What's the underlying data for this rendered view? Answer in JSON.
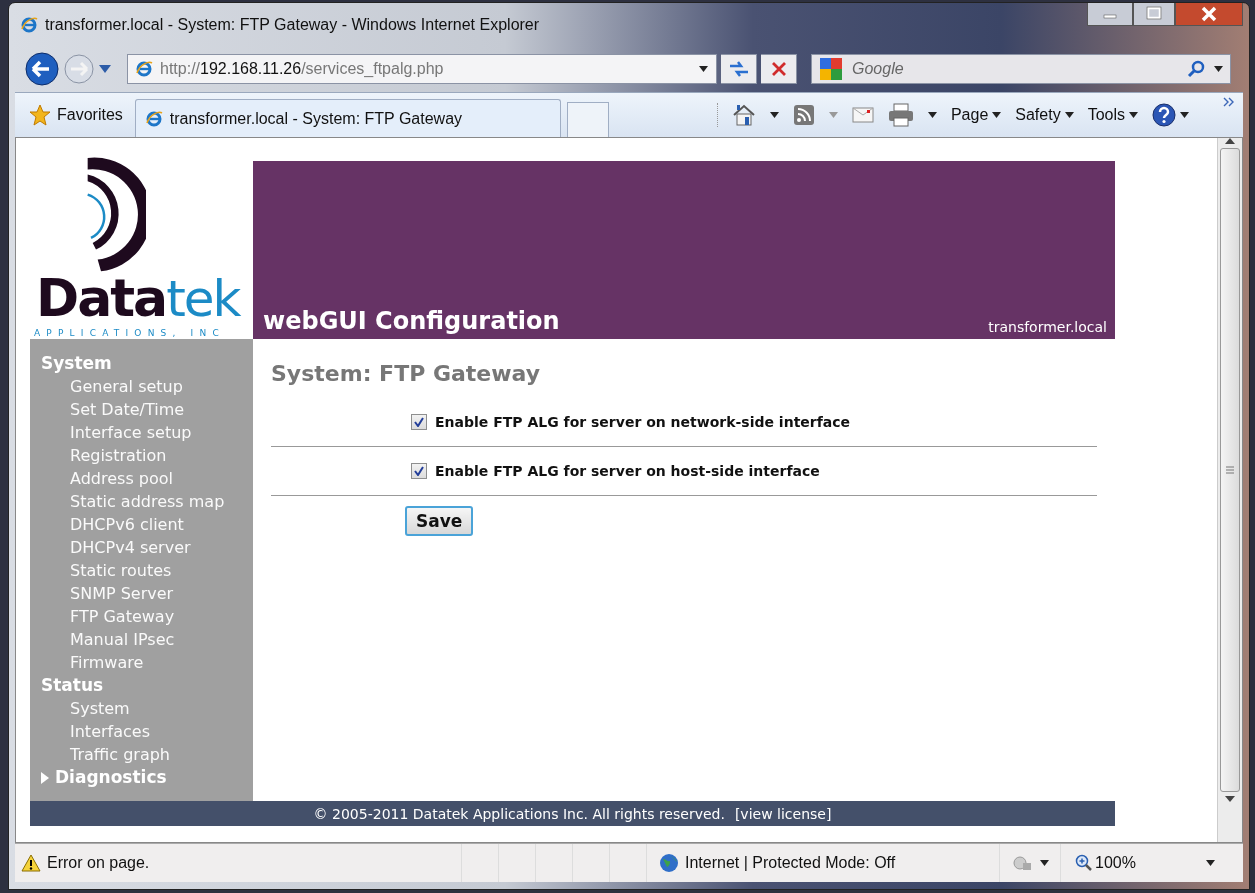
{
  "window": {
    "title": "transformer.local - System: FTP Gateway - Windows Internet Explorer"
  },
  "address_bar": {
    "scheme": "http://",
    "host": "192.168.11.26",
    "path": "/services_ftpalg.php"
  },
  "search": {
    "placeholder": "Google"
  },
  "favorites_label": "Favorites",
  "tabs": [
    {
      "label": "transformer.local - System: FTP Gateway",
      "selected": true
    }
  ],
  "commands": [
    {
      "label": "Page"
    },
    {
      "label": "Safety"
    },
    {
      "label": "Tools"
    }
  ],
  "page": {
    "logo": {
      "word_bold": "Data",
      "word_light": "tek",
      "tagline": "APPLICATIONS, INC"
    },
    "banner": {
      "title": "webGUI Configuration",
      "hostname": "transformer.local"
    },
    "sidebar": [
      {
        "label": "System",
        "expanded": true,
        "children": [
          {
            "label": "General setup"
          },
          {
            "label": "Set Date/Time"
          },
          {
            "label": "Interface setup"
          },
          {
            "label": "Registration"
          },
          {
            "label": "Address pool"
          },
          {
            "label": "Static address map"
          },
          {
            "label": "DHCPv6 client"
          },
          {
            "label": "DHCPv4 server"
          },
          {
            "label": "Static routes"
          },
          {
            "label": "SNMP Server"
          },
          {
            "label": "FTP Gateway"
          },
          {
            "label": "Manual IPsec"
          },
          {
            "label": "Firmware"
          }
        ]
      },
      {
        "label": "Status",
        "expanded": true,
        "children": [
          {
            "label": "System"
          },
          {
            "label": "Interfaces"
          },
          {
            "label": "Traffic graph"
          }
        ]
      },
      {
        "label": "Diagnostics",
        "expanded": false
      }
    ],
    "heading": "System: FTP Gateway",
    "options": [
      {
        "label": "Enable FTP ALG for server on network-side interface",
        "checked": true
      },
      {
        "label": "Enable FTP ALG for server on host-side interface",
        "checked": true
      }
    ],
    "save_button": "Save",
    "footer": {
      "text": "© 2005-2011 Datatek Applications Inc. All rights reserved.",
      "link": "[view license]"
    }
  },
  "status_bar": {
    "message": "Error on page.",
    "zone": "Internet | Protected Mode: Off",
    "zoom": "100%"
  }
}
